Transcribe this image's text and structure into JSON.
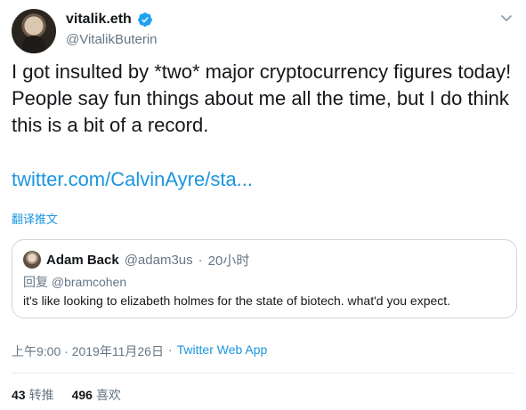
{
  "author": {
    "display_name": "vitalik.eth",
    "handle": "@VitalikButerin"
  },
  "tweet": {
    "text": "I got insulted by *two* major cryptocurrency figures today! People say fun things about me all the time, but I do think this is a bit of a record.",
    "link": "twitter.com/CalvinAyre/sta...",
    "translate_label": "翻译推文"
  },
  "quote": {
    "display_name": "Adam Back",
    "handle": "@adam3us",
    "separator": "·",
    "time": "20小时",
    "reply_to": "回复 @bramcohen",
    "text": "it's like looking to elizabeth holmes for the state of biotech. what'd you expect."
  },
  "meta": {
    "timestamp": "上午9:00 · 2019年11月26日",
    "separator": "·",
    "app": "Twitter Web App"
  },
  "stats": {
    "retweets": "43",
    "retweets_label": "转推",
    "likes": "496",
    "likes_label": "喜欢"
  },
  "colors": {
    "link": "#1b95e0",
    "secondary_text": "#657786",
    "border": "#ccd6dd",
    "verified": "#1da1f2"
  },
  "icons": {
    "verified": "verified-badge-icon",
    "caret": "chevron-down-icon"
  }
}
